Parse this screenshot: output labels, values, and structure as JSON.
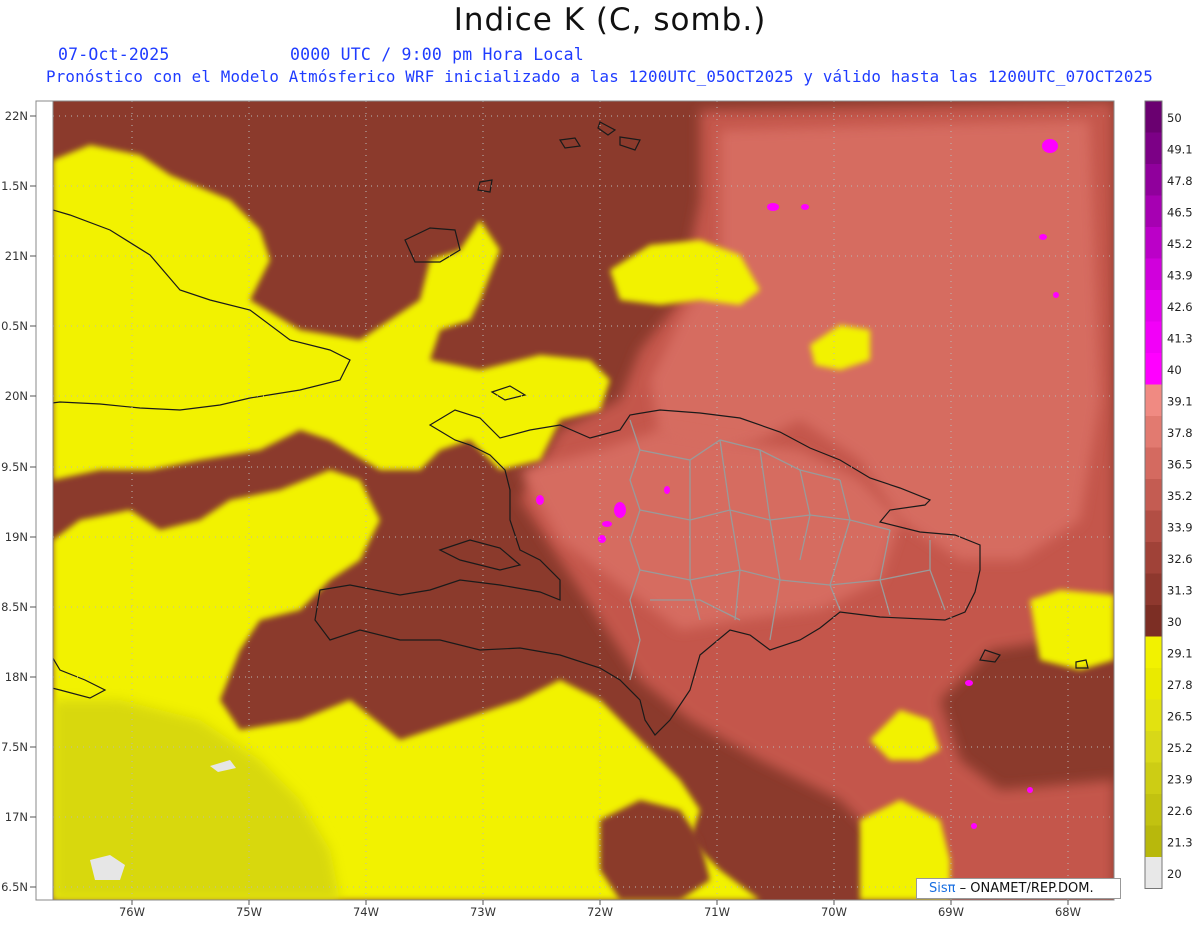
{
  "header": {
    "title": "Indice K (C, somb.)",
    "date": "07-Oct-2025",
    "valid_time": "0000 UTC / 9:00 pm Hora Local",
    "forecast_note": "Pronóstico con el Modelo Atmósferico WRF inicializado a las 1200UTC_05OCT2025 y válido hasta las  1200UTC_07OCT2025"
  },
  "axes": {
    "lat_labels": [
      "22N",
      "1.5N",
      "21N",
      "0.5N",
      "20N",
      "9.5N",
      "19N",
      "8.5N",
      "18N",
      "7.5N",
      "17N",
      "6.5N"
    ],
    "lon_labels": [
      "76W",
      "75W",
      "74W",
      "73W",
      "72W",
      "71W",
      "70W",
      "69W",
      "68W"
    ]
  },
  "colorbar": {
    "labels": [
      "50",
      "49.1",
      "47.8",
      "46.5",
      "45.2",
      "43.9",
      "42.6",
      "41.3",
      "40",
      "39.1",
      "37.8",
      "36.5",
      "35.2",
      "33.9",
      "32.6",
      "31.3",
      "30",
      "29.1",
      "27.8",
      "26.5",
      "25.2",
      "23.9",
      "22.6",
      "21.3",
      "20"
    ],
    "colors": [
      "#6a0070",
      "#7c0086",
      "#90009c",
      "#a600b2",
      "#bb00c8",
      "#d000dc",
      "#e400ee",
      "#f200f8",
      "#ff00ff",
      "#f08a82",
      "#e27a70",
      "#d46a60",
      "#c45c52",
      "#b24e44",
      "#a04238",
      "#8e382e",
      "#7c2e24",
      "#f2f200",
      "#eaea00",
      "#e2e210",
      "#d8d818",
      "#cdcd14",
      "#c2c210",
      "#b8b80c",
      "#e8e8e8"
    ]
  },
  "legend_credit": {
    "brand": "Sisπ",
    "text": "– ONAMET/REP.DOM."
  },
  "map_colors": {
    "yellow": "#f2f200",
    "olive": "#d8d80e",
    "brown": "#8b3a2c",
    "red": "#c4574c",
    "pink": "#d66c60",
    "magenta": "#ff00ff",
    "coast": "#1a1a1a",
    "provinces": "#9a9a9a"
  }
}
